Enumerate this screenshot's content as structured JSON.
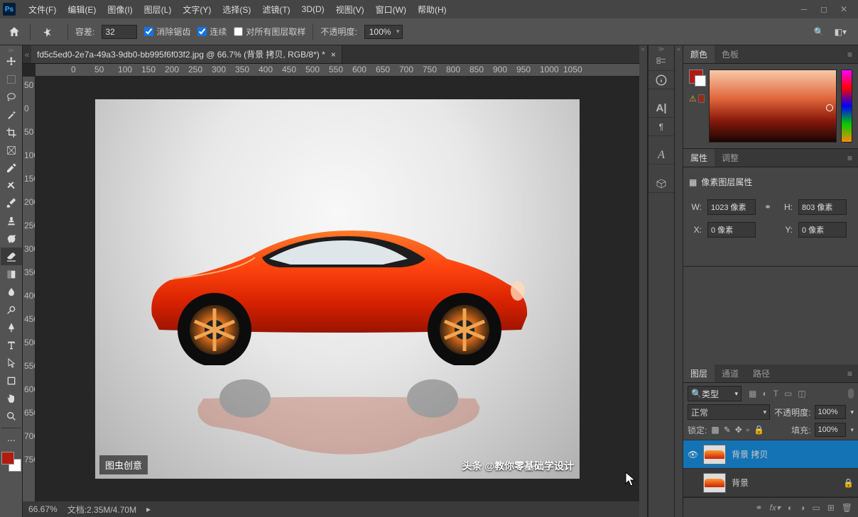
{
  "menu": {
    "file": "文件(F)",
    "edit": "编辑(E)",
    "image": "图像(I)",
    "layer": "图层(L)",
    "type": "文字(Y)",
    "select": "选择(S)",
    "filter": "滤镜(T)",
    "3d": "3D(D)",
    "view": "视图(V)",
    "window": "窗口(W)",
    "help": "帮助(H)"
  },
  "options": {
    "tolerance_label": "容差:",
    "tolerance_value": "32",
    "antialias": "消除锯齿",
    "contiguous": "连续",
    "all_layers": "对所有图层取样",
    "opacity_label": "不透明度:",
    "opacity_value": "100%"
  },
  "document": {
    "tab": "fd5c5ed0-2e7a-49a3-9db0-bb995f6f03f2.jpg @ 66.7% (背景 拷贝, RGB/8*) *"
  },
  "ruler_h": [
    "0",
    "50",
    "100",
    "150",
    "200",
    "250",
    "300",
    "350",
    "400",
    "450",
    "500",
    "550",
    "600",
    "650",
    "700",
    "750",
    "800",
    "850",
    "900",
    "950",
    "1000",
    "1050"
  ],
  "ruler_v": [
    "50",
    "0",
    "50",
    "100",
    "150",
    "200",
    "250",
    "300",
    "350",
    "400",
    "450",
    "500",
    "550",
    "600",
    "650",
    "700",
    "750"
  ],
  "watermark": {
    "tl": "图虫创意",
    "br": "头条 @教你零基础学设计"
  },
  "status": {
    "zoom": "66.67%",
    "doc": "文档:2.35M/4.70M"
  },
  "panel_tabs": {
    "color": "颜色",
    "swatches": "色板",
    "properties": "属性",
    "adjustments": "调整",
    "layers": "图层",
    "channels": "通道",
    "paths": "路径"
  },
  "properties": {
    "title": "像素图层属性",
    "w_label": "W:",
    "w_value": "1023 像素",
    "h_label": "H:",
    "h_value": "803 像素",
    "x_label": "X:",
    "x_value": "0 像素",
    "y_label": "Y:",
    "y_value": "0 像素"
  },
  "layers_panel": {
    "filter": "类型",
    "blend": "正常",
    "opacity_label": "不透明度:",
    "opacity": "100%",
    "lock_label": "锁定:",
    "fill_label": "填充:",
    "fill": "100%"
  },
  "layers": [
    {
      "name": "背景 拷贝",
      "visible": true,
      "selected": true,
      "locked": false
    },
    {
      "name": "背景",
      "visible": false,
      "selected": false,
      "locked": true
    }
  ],
  "search_icon": "🔍"
}
